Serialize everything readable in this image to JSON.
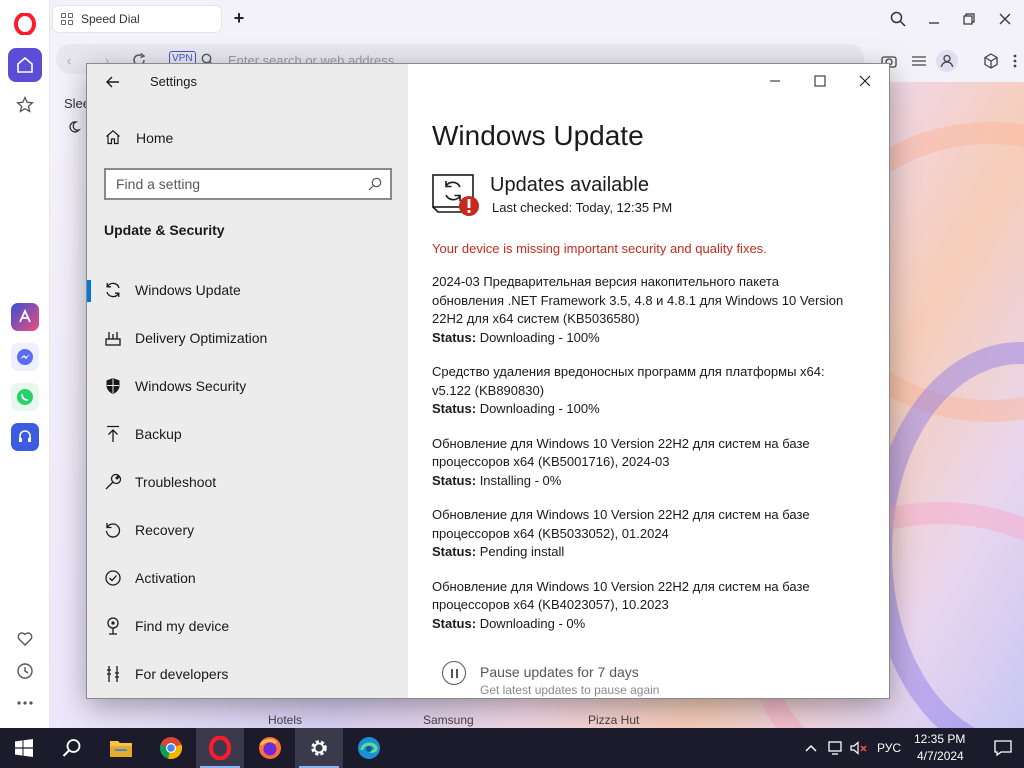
{
  "colors": {
    "accent": "#0078d4",
    "warning": "#c42b1c",
    "opera_red": "#ff1b2d",
    "opera_purple": "#5b4dd6",
    "taskbar": "#1b1b2b"
  },
  "browser": {
    "tab_title": "Speed Dial",
    "vpn_label": "VPN",
    "address_placeholder": "Enter search or web address",
    "sidebar_partial_label": "Slee",
    "speed_dial_labels": [
      "Hotels",
      "Samsung",
      "Pizza Hut"
    ]
  },
  "settings": {
    "app_title": "Settings",
    "home_label": "Home",
    "search_placeholder": "Find a setting",
    "section_heading": "Update & Security",
    "nav_items": [
      {
        "label": "Windows Update",
        "icon": "sync-icon",
        "active": true
      },
      {
        "label": "Delivery Optimization",
        "icon": "delivery-optimization-icon",
        "active": false
      },
      {
        "label": "Windows Security",
        "icon": "shield-icon",
        "active": false
      },
      {
        "label": "Backup",
        "icon": "backup-arrow-icon",
        "active": false
      },
      {
        "label": "Troubleshoot",
        "icon": "wrench-icon",
        "active": false
      },
      {
        "label": "Recovery",
        "icon": "recovery-icon",
        "active": false
      },
      {
        "label": "Activation",
        "icon": "check-circle-icon",
        "active": false
      },
      {
        "label": "Find my device",
        "icon": "location-pin-icon",
        "active": false
      },
      {
        "label": "For developers",
        "icon": "developer-tools-icon",
        "active": false
      }
    ],
    "page_title": "Windows Update",
    "status_heading": "Updates available",
    "last_checked": "Last checked: Today, 12:35 PM",
    "warning": "Your device is missing important security and quality fixes.",
    "status_label": "Status:",
    "updates": [
      {
        "title": "2024-03 Предварительная версия накопительного пакета обновления .NET Framework 3.5, 4.8 и 4.8.1 для Windows 10 Version 22H2 для x64 систем (KB5036580)",
        "status": "Downloading - 100%"
      },
      {
        "title": "Средство удаления вредоносных программ для платформы x64: v5.122 (KB890830)",
        "status": "Downloading - 100%"
      },
      {
        "title": "Обновление для Windows 10 Version 22H2 для систем на базе процессоров x64 (KB5001716), 2024-03",
        "status": "Installing - 0%"
      },
      {
        "title": "Обновление для Windows 10 Version 22H2 для систем на базе процессоров x64 (KB5033052), 01.2024",
        "status": "Pending install"
      },
      {
        "title": "Обновление для Windows 10 Version 22H2 для систем на базе процессоров x64 (KB4023057), 10.2023",
        "status": "Downloading - 0%"
      }
    ],
    "pause_title": "Pause updates for 7 days",
    "pause_subtitle": "Get latest updates to pause again"
  },
  "taskbar": {
    "apps": [
      "start-icon",
      "search-icon",
      "file-explorer-icon",
      "chrome-icon",
      "opera-icon",
      "firefox-icon",
      "settings-gear-icon",
      "edge-icon"
    ],
    "language": "РУС",
    "time": "12:35 PM",
    "date": "4/7/2024"
  }
}
